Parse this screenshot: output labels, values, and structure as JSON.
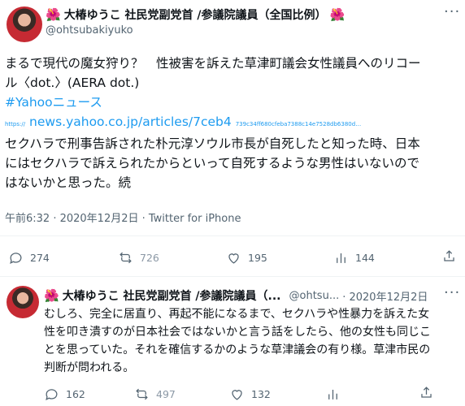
{
  "tweet1": {
    "flower_icon": "hibiscus-icon",
    "author_name": "大椿ゆうこ 社民党副党首 /参議院議員（全国比例）",
    "handle": "@ohtsubakiyuko",
    "line1": "まるで現代の魔女狩り？　性被害を訴えた草津町議会女性議員へのリコー",
    "line2": "ル〈dot.〉(AERA dot.)",
    "hashtag": "#Yahooニュース",
    "url_prefix": "https://",
    "url_main": "news.yahoo.co.jp/articles/7ceb4",
    "url_tail": "739c34ff680cfeba7388c14e7528db6380d…",
    "line3": "セクハラで刑事告訴された朴元淳ソウル市長が自死したと知った時、日本",
    "line4": "にはセクハラで訴えられたからといって自死するような男性はいないので",
    "line5": "はないかと思った。続",
    "timestamp": "午前6:32 · 2020年12月2日 · Twitter for iPhone",
    "replies": "274",
    "retweets": "726",
    "likes": "195",
    "views": "144"
  },
  "tweet2": {
    "author_name": "大椿ゆうこ 社民党副党首 /参議院議員（...",
    "handle": "@ohtsu...",
    "date": "· 2020年12月2日",
    "line1": "むしろ、完全に居直り、再起不能になるまで、セクハラや性暴力を訴えた女",
    "line2": "性を叩き潰すのが日本社会ではないかと言う話をしたら、他の女性も同じこ",
    "line3": "とを思っていた。それを確信するかのような草津議会の有り様。草津市民の",
    "line4": "判断が問われる。",
    "replies": "162",
    "retweets": "497",
    "likes": "132"
  },
  "colors": {
    "link": "#1d9bf0",
    "muted": "#536471",
    "text": "#0f1419"
  }
}
